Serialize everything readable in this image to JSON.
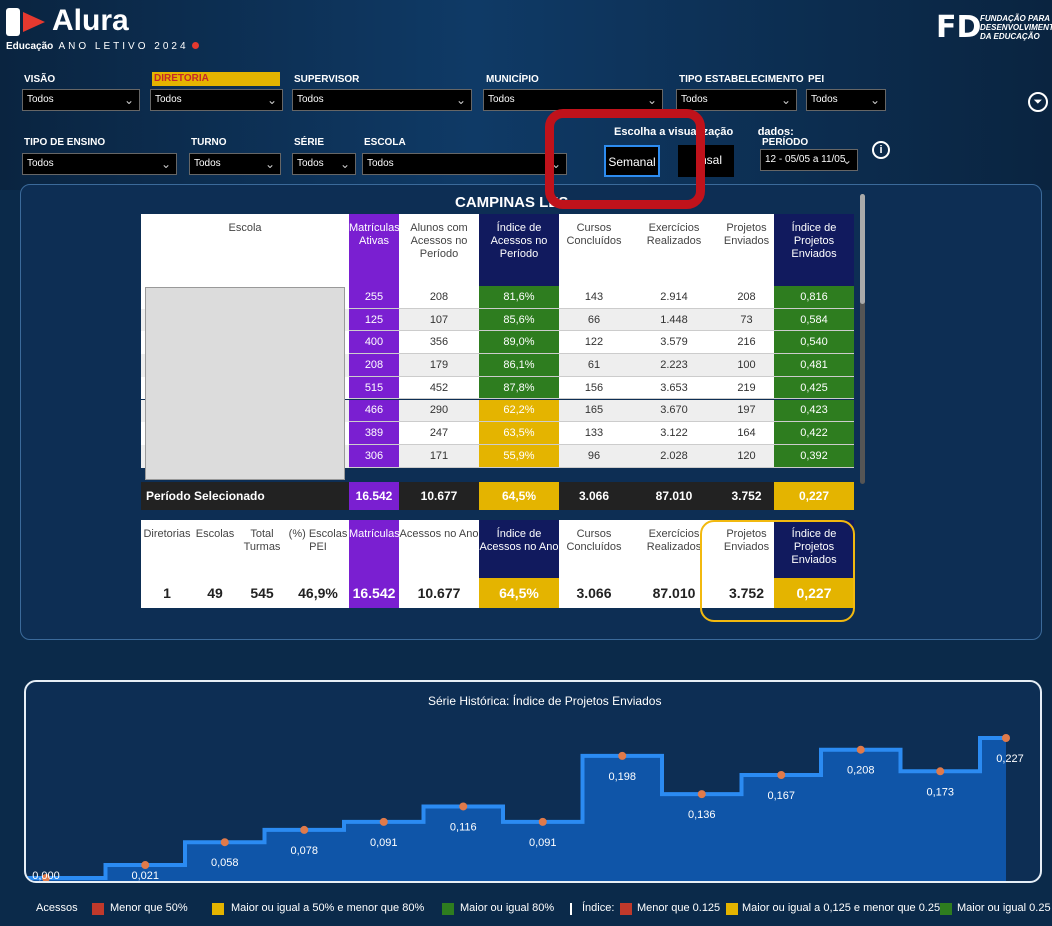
{
  "app": {
    "brand": "Alura",
    "brand_sub_bold": "Educação",
    "brand_sub": "ANO LETIVO 2024",
    "org_mark": "FD",
    "org_line1": "FUNDAÇÃO PARA O",
    "org_line2": "DESENVOLVIMENTO",
    "org_line3": "DA EDUCAÇÃO"
  },
  "filters": {
    "visao": {
      "label": "VISÃO",
      "value": "Todos"
    },
    "diretoria": {
      "label": "DIRETORIA",
      "value": "Todos"
    },
    "supervisor": {
      "label": "SUPERVISOR",
      "value": "Todos"
    },
    "municipio": {
      "label": "MUNICÍPIO",
      "value": "Todos"
    },
    "tipo_estab": {
      "label": "TIPO ESTABELECIMENTO",
      "value": "Todos"
    },
    "pei": {
      "label": "PEI",
      "value": "Todos"
    },
    "tipo_ensino": {
      "label": "TIPO DE ENSINO",
      "value": "Todos"
    },
    "turno": {
      "label": "TURNO",
      "value": "Todos"
    },
    "serie": {
      "label": "SÉRIE",
      "value": "Todos"
    },
    "escola": {
      "label": "ESCOLA",
      "value": "Todos"
    },
    "periodo": {
      "label": "PERÍODO",
      "value": "12 - 05/05 a 11/05"
    }
  },
  "view": {
    "label_a": "Escolha a visualização",
    "label_b": "dados:",
    "semanal": "Semanal",
    "mensal_partial": "nsal"
  },
  "table": {
    "title": "CAMPINAS LES",
    "headers": [
      "Escola",
      "Matrículas Ativas",
      "Alunos com Acessos no Período",
      "Índice de Acessos no Período",
      "Cursos Concluídos",
      "Exercícios Realizados",
      "Projetos Enviados",
      "Índice de Projetos Enviados"
    ],
    "rows": [
      {
        "mat": "255",
        "alunos": "208",
        "ind": "81,6%",
        "cursos": "143",
        "exerc": "2.914",
        "proj": "208",
        "indp": "0,816",
        "level": "high"
      },
      {
        "mat": "125",
        "alunos": "107",
        "ind": "85,6%",
        "cursos": "66",
        "exerc": "1.448",
        "proj": "73",
        "indp": "0,584",
        "level": "high"
      },
      {
        "mat": "400",
        "alunos": "356",
        "ind": "89,0%",
        "cursos": "122",
        "exerc": "3.579",
        "proj": "216",
        "indp": "0,540",
        "level": "high"
      },
      {
        "mat": "208",
        "alunos": "179",
        "ind": "86,1%",
        "cursos": "61",
        "exerc": "2.223",
        "proj": "100",
        "indp": "0,481",
        "level": "high"
      },
      {
        "mat": "515",
        "alunos": "452",
        "ind": "87,8%",
        "cursos": "156",
        "exerc": "3.653",
        "proj": "219",
        "indp": "0,425",
        "level": "high"
      },
      {
        "mat": "466",
        "alunos": "290",
        "ind": "62,2%",
        "cursos": "165",
        "exerc": "3.670",
        "proj": "197",
        "indp": "0,423",
        "level": "mid"
      },
      {
        "mat": "389",
        "alunos": "247",
        "ind": "63,5%",
        "cursos": "133",
        "exerc": "3.122",
        "proj": "164",
        "indp": "0,422",
        "level": "mid"
      },
      {
        "mat": "306",
        "alunos": "171",
        "ind": "55,9%",
        "cursos": "96",
        "exerc": "2.028",
        "proj": "120",
        "indp": "0,392",
        "level": "mid"
      }
    ],
    "total": {
      "label": "Período Selecionado",
      "mat": "16.542",
      "alunos": "10.677",
      "ind": "64,5%",
      "cursos": "3.066",
      "exerc": "87.010",
      "proj": "3.752",
      "indp": "0,227"
    }
  },
  "summary": {
    "headers": [
      "Diretorias",
      "Escolas",
      "Total Turmas",
      "(%) Escolas PEI",
      "Matrículas",
      "Acessos no Ano",
      "Índice de Acessos no Ano",
      "Cursos Concluídos",
      "Exercícios Realizados",
      "Projetos Enviados",
      "Índice de Projetos Enviados"
    ],
    "values": [
      "1",
      "49",
      "545",
      "46,9%",
      "16.542",
      "10.677",
      "64,5%",
      "3.066",
      "87.010",
      "3.752",
      "0,227"
    ]
  },
  "chart_data": {
    "type": "area",
    "title": "Série Histórica: Índice de Projetos Enviados",
    "x": [
      1,
      2,
      3,
      4,
      5,
      6,
      7,
      8,
      9,
      10,
      11,
      12
    ],
    "values": [
      0.0,
      0.021,
      0.058,
      0.078,
      0.091,
      0.116,
      0.091,
      0.198,
      0.136,
      0.167,
      0.208,
      0.173,
      0.227
    ],
    "labels": [
      "0,000",
      "0,021",
      "0,058",
      "0,078",
      "0,091",
      "0,116",
      "0,091",
      "0,198",
      "0,136",
      "0,167",
      "0,208",
      "0,173",
      "0,227"
    ],
    "line_color": "#2b8bf2",
    "area_color": "#0f55a8",
    "marker_color": "#e07a4a"
  },
  "legend": {
    "acessos": "Acessos",
    "a1": "Menor que 50%",
    "a2": "Maior ou igual a 50% e menor que 80%",
    "a3": "Maior ou igual 80%",
    "indice": "Índice:",
    "i1": "Menor que 0.125",
    "i2": "Maior ou igual a 0,125 e menor que 0.25",
    "i3": "Maior ou igual 0.25"
  },
  "colors": {
    "purple": "#7a1fd1",
    "navy": "#111a5e",
    "green": "#2e7d1f",
    "yellow": "#e4b400",
    "red": "#c0392b"
  }
}
